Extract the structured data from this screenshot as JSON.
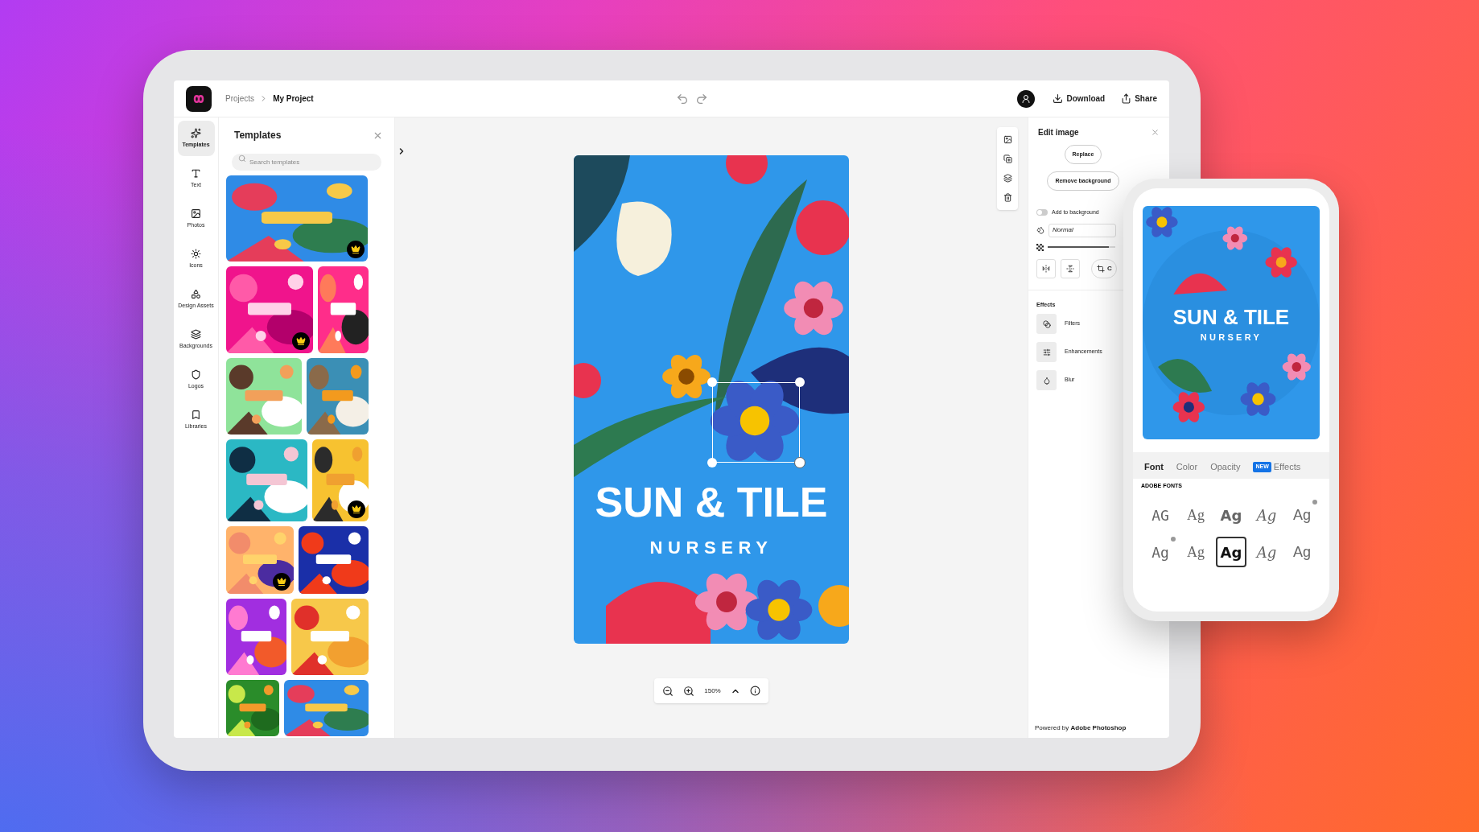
{
  "header": {
    "breadcrumbs": [
      {
        "label": "Projects",
        "selected": false
      },
      {
        "label": "My Project",
        "selected": true
      }
    ],
    "download": "Download",
    "share": "Share"
  },
  "rail": [
    {
      "label": "Templates",
      "selected": true
    },
    {
      "label": "Text",
      "selected": false
    },
    {
      "label": "Photos",
      "selected": false
    },
    {
      "label": "Icons",
      "selected": false
    },
    {
      "label": "Design Assets",
      "selected": false
    },
    {
      "label": "Backgrounds",
      "selected": false
    },
    {
      "label": "Logos",
      "selected": false
    },
    {
      "label": "Libraries",
      "selected": false
    }
  ],
  "templates_panel": {
    "title": "Templates",
    "search": {
      "placeholder": "Search templates"
    },
    "rows": [
      [
        {
          "kind": "picture",
          "premium": true
        }
      ],
      [
        {
          "kind": "picture",
          "premium": true
        },
        {
          "kind": "picture",
          "premium": false
        }
      ],
      [
        {
          "kind": "picture",
          "premium": false
        },
        {
          "kind": "picture",
          "premium": false
        }
      ],
      [
        {
          "kind": "picture",
          "premium": false
        },
        {
          "kind": "picture",
          "premium": true
        }
      ],
      [
        {
          "kind": "picture",
          "premium": true
        },
        {
          "kind": "picture",
          "premium": false
        }
      ],
      [
        {
          "kind": "picture",
          "premium": false
        },
        {
          "kind": "picture",
          "premium": false
        }
      ],
      [
        {
          "kind": "picture",
          "premium": false
        },
        {
          "kind": "picture",
          "premium": false
        }
      ]
    ]
  },
  "canvas": {
    "title": "SUN & TILE",
    "subtitle": "NURSERY",
    "zoom": "150%"
  },
  "edit_panel": {
    "title": "Edit image",
    "buttons": [
      "Replace",
      "Remove background"
    ],
    "toggle": {
      "label": "Add to background",
      "on": false
    },
    "blend_mode": "Normal",
    "opacity": {
      "level": 0.9
    },
    "crop": "C",
    "effects_title": "Effects",
    "effects": [
      "Filters",
      "Enhancements",
      "Blur"
    ],
    "footer": "Powered by **Adobe Photoshop**"
  },
  "phone": {
    "title": "SUN & TILE",
    "subtitle": "NURSERY",
    "tabs": [
      {
        "label": "Font",
        "selected": true
      },
      {
        "label": "Color",
        "selected": false
      },
      {
        "label": "Opacity",
        "selected": false
      },
      {
        "label": "Effects",
        "selected": false,
        "badge": "NEW"
      }
    ],
    "section": "ADOBE FONTS",
    "fonts": [
      {
        "sample": "AG",
        "selected": false,
        "marked": false
      },
      {
        "sample": "Ag",
        "selected": false,
        "marked": false
      },
      {
        "sample": "Ag",
        "selected": false,
        "marked": false
      },
      {
        "sample": "Ag",
        "selected": false,
        "marked": false
      },
      {
        "sample": "Ag",
        "selected": false,
        "marked": true
      },
      {
        "sample": "Ag",
        "selected": false,
        "marked": true
      },
      {
        "sample": "Ag",
        "selected": false,
        "marked": false
      },
      {
        "sample": "Ag",
        "selected": true,
        "marked": false
      },
      {
        "sample": "Ag",
        "selected": false,
        "marked": false
      },
      {
        "sample": "Ag",
        "selected": false,
        "marked": false
      }
    ]
  }
}
